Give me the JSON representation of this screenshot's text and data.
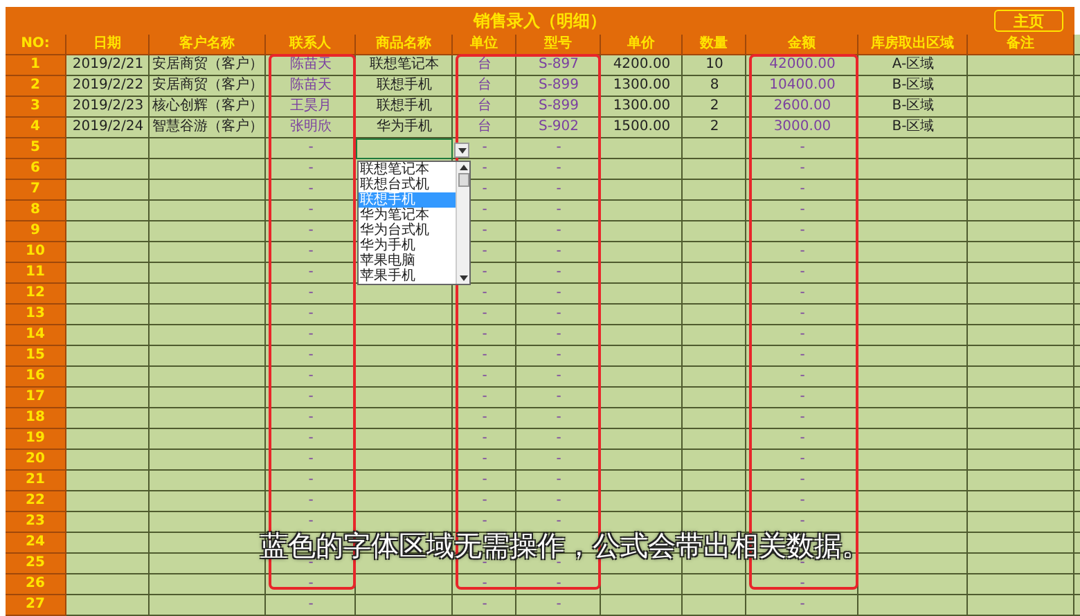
{
  "title": "销售录入（明细）",
  "home_button": "主页",
  "columns": [
    {
      "label": "NO:",
      "formula": false
    },
    {
      "label": "日期",
      "formula": false
    },
    {
      "label": "客户名称",
      "formula": false
    },
    {
      "label": "联系人",
      "formula": true
    },
    {
      "label": "商品名称",
      "formula": false
    },
    {
      "label": "单位",
      "formula": true
    },
    {
      "label": "型号",
      "formula": true
    },
    {
      "label": "单价",
      "formula": false
    },
    {
      "label": "数量",
      "formula": false
    },
    {
      "label": "金额",
      "formula": true
    },
    {
      "label": "库房取出区域",
      "formula": false
    },
    {
      "label": "备注",
      "formula": false
    }
  ],
  "rows": [
    {
      "no": "1",
      "date": "2019/2/21",
      "customer": "安居商贸（客户）",
      "contact": "陈苗天",
      "product": "联想笔记本",
      "unit": "台",
      "model": "S-897",
      "price": "4200.00",
      "qty": "10",
      "amount": "42000.00",
      "warehouse": "A-区域"
    },
    {
      "no": "2",
      "date": "2019/2/22",
      "customer": "安居商贸（客户）",
      "contact": "陈苗天",
      "product": "联想手机",
      "unit": "台",
      "model": "S-899",
      "price": "1300.00",
      "qty": "8",
      "amount": "10400.00",
      "warehouse": "B-区域"
    },
    {
      "no": "3",
      "date": "2019/2/23",
      "customer": "核心创辉（客户）",
      "contact": "王昊月",
      "product": "联想手机",
      "unit": "台",
      "model": "S-899",
      "price": "1300.00",
      "qty": "2",
      "amount": "2600.00",
      "warehouse": "B-区域"
    },
    {
      "no": "4",
      "date": "2019/2/24",
      "customer": "智慧谷游（客户）",
      "contact": "张明欣",
      "product": "华为手机",
      "unit": "台",
      "model": "S-902",
      "price": "1500.00",
      "qty": "2",
      "amount": "3000.00",
      "warehouse": "B-区域"
    },
    {
      "no": "5",
      "contact": "-",
      "unit": "-",
      "model": "-",
      "amount": "-"
    },
    {
      "no": "6",
      "contact": "-",
      "unit": "-",
      "model": "-",
      "amount": "-"
    },
    {
      "no": "7",
      "contact": "-",
      "unit": "-",
      "model": "-",
      "amount": "-"
    },
    {
      "no": "8",
      "contact": "-",
      "unit": "-",
      "model": "-",
      "amount": "-"
    },
    {
      "no": "9",
      "contact": "-",
      "unit": "-",
      "model": "-",
      "amount": "-"
    },
    {
      "no": "10",
      "contact": "-",
      "unit": "-",
      "model": "-",
      "amount": "-"
    },
    {
      "no": "11",
      "contact": "-",
      "unit": "-",
      "model": "-",
      "amount": "-"
    },
    {
      "no": "12",
      "contact": "-",
      "unit": "-",
      "model": "-",
      "amount": "-"
    },
    {
      "no": "13",
      "contact": "-",
      "unit": "-",
      "model": "-",
      "amount": "-"
    },
    {
      "no": "14",
      "contact": "-",
      "unit": "-",
      "model": "-",
      "amount": "-"
    },
    {
      "no": "15",
      "contact": "-",
      "unit": "-",
      "model": "-",
      "amount": "-"
    },
    {
      "no": "16",
      "contact": "-",
      "unit": "-",
      "model": "-",
      "amount": "-"
    },
    {
      "no": "17",
      "contact": "-",
      "unit": "-",
      "model": "-",
      "amount": "-"
    },
    {
      "no": "18",
      "contact": "-",
      "unit": "-",
      "model": "-",
      "amount": "-"
    },
    {
      "no": "19",
      "contact": "-",
      "unit": "-",
      "model": "-",
      "amount": "-"
    },
    {
      "no": "20",
      "contact": "-",
      "unit": "-",
      "model": "-",
      "amount": "-"
    },
    {
      "no": "21",
      "contact": "-",
      "unit": "-",
      "model": "-",
      "amount": "-"
    },
    {
      "no": "22",
      "contact": "-",
      "unit": "-",
      "model": "-",
      "amount": "-"
    },
    {
      "no": "23",
      "contact": "-",
      "unit": "-",
      "model": "-",
      "amount": "-"
    },
    {
      "no": "24"
    },
    {
      "no": "25",
      "contact": "-",
      "unit": "-",
      "model": "-",
      "amount": "-"
    },
    {
      "no": "26",
      "contact": "-",
      "unit": "-",
      "model": "-",
      "amount": "-"
    },
    {
      "no": "27",
      "contact": "-",
      "unit": "-",
      "model": "-",
      "amount": "-"
    }
  ],
  "dropdown": {
    "items": [
      {
        "label": "联想笔记本",
        "selected": false
      },
      {
        "label": "联想台式机",
        "selected": false
      },
      {
        "label": "联想手机",
        "selected": true
      },
      {
        "label": "华为笔记本",
        "selected": false
      },
      {
        "label": "华为台式机",
        "selected": false
      },
      {
        "label": "华为手机",
        "selected": false
      },
      {
        "label": "苹果电脑",
        "selected": false
      },
      {
        "label": "苹果手机",
        "selected": false
      }
    ]
  },
  "caption": "蓝色的字体区域无需操作，公式会带出相关数据。"
}
